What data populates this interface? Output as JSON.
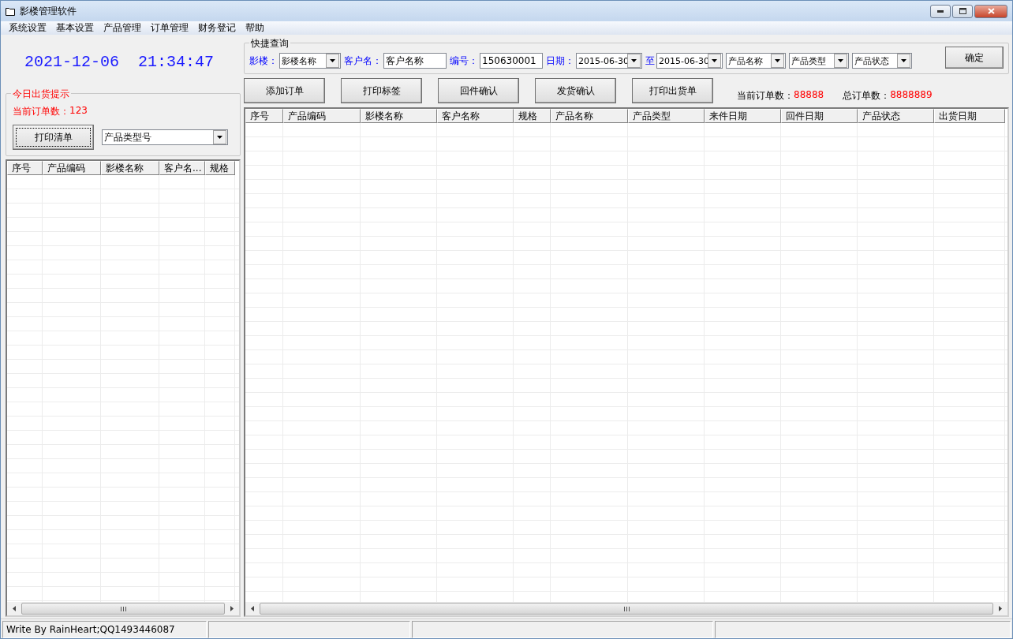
{
  "window": {
    "title": "影楼管理软件"
  },
  "menu": [
    "系统设置",
    "基本设置",
    "产品管理",
    "订单管理",
    "财务登记",
    "帮助"
  ],
  "clock": {
    "date": "2021-12-06",
    "time": "21:34:47"
  },
  "shipment_panel": {
    "title": "今日出货提示",
    "count_label": "当前订单数：",
    "count": "123",
    "print_button": "打印清单",
    "type_dropdown": "产品类型号"
  },
  "left_table": {
    "columns": [
      "序号",
      "产品编码",
      "影楼名称",
      "客户名...",
      "规格"
    ]
  },
  "quick_query": {
    "title": "快捷查询",
    "fields": [
      {
        "label": "影楼：",
        "kind": "dropdown",
        "value": "影楼名称"
      },
      {
        "label": "客户名：",
        "kind": "input",
        "value": "客户名称"
      },
      {
        "label": "编号：",
        "kind": "input",
        "value": "150630001"
      },
      {
        "label": "日期：",
        "kind": "dropdown",
        "value": "2015-06-30"
      },
      {
        "label": "至",
        "kind": "dropdown",
        "value": "2015-06-30"
      },
      {
        "kind": "dropdown",
        "value": "产品名称"
      },
      {
        "kind": "dropdown",
        "value": "产品类型"
      },
      {
        "kind": "dropdown",
        "value": "产品状态"
      }
    ],
    "confirm_button": "确定"
  },
  "toolbar": [
    "添加订单",
    "打印标签",
    "回件确认",
    "发货确认",
    "打印出货单"
  ],
  "counters": [
    {
      "label": "当前订单数：",
      "value": "88888"
    },
    {
      "label": "总订单数：",
      "value": "8888889"
    }
  ],
  "main_table": {
    "columns": [
      "序号",
      "产品编码",
      "影楼名称",
      "客户名称",
      "规格",
      "产品名称",
      "产品类型",
      "来件日期",
      "回件日期",
      "产品状态",
      "出货日期"
    ]
  },
  "status_bar": [
    "Write By RainHeart;QQ1493446087"
  ]
}
